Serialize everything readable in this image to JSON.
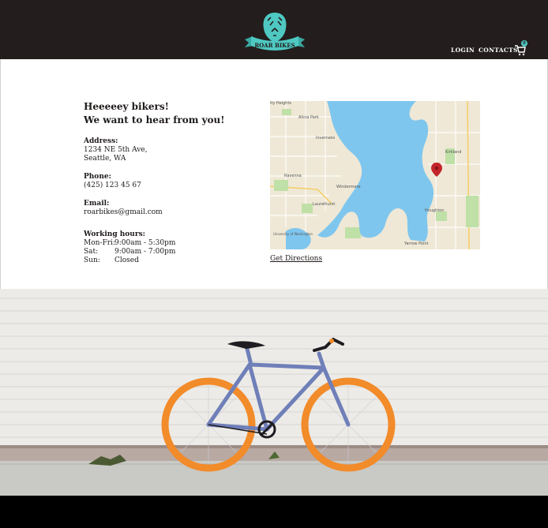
{
  "header": {
    "brand": "ROAR BIKES",
    "nav": [
      {
        "label": "LOGIN"
      },
      {
        "label": "CONTACTS"
      }
    ],
    "cart_count": "0",
    "bg_color": "#231e1d",
    "accent_color": "#4fc8c2"
  },
  "contact": {
    "greeting_line1": "Heeeeey bikers!",
    "greeting_line2": "We want to hear from you!",
    "address_label": "Address:",
    "address_line1": "1234 NE 5th Ave,",
    "address_line2": "Seattle, WA",
    "phone_label": "Phone:",
    "phone": "(425) 123 45 67",
    "email_label": "Email:",
    "email": "roarbikes@gmail.com",
    "hours_label": "Working hours:",
    "hours": [
      {
        "day": "Mon-Fri:",
        "time": "9:00am - 5:30pm"
      },
      {
        "day": "Sat:",
        "time": "9:00am - 7:00pm"
      },
      {
        "day": "Sun:",
        "time": "Closed"
      }
    ]
  },
  "map": {
    "places": [
      "Alicia Park",
      "Inverness",
      "Kirkland",
      "Ravenna",
      "Windermere",
      "Laurelhurst",
      "Houghton",
      "Yarrow Point",
      "ity Heights",
      "University of Washington"
    ],
    "directions_label": "Get Directions"
  }
}
